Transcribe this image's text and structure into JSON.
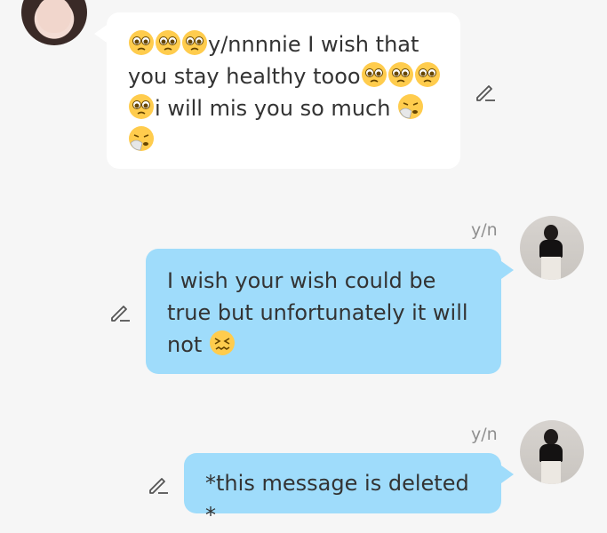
{
  "messages": [
    {
      "direction": "incoming",
      "text": "🥺🥺🥺y/nnnnie I wish that you stay healthy tooo🥺🥺🥺🥺i will mis you so much 🤧🤧"
    },
    {
      "direction": "outgoing",
      "sender": "y/n",
      "text": "I wish your wish could be true but unfortunately it will not 😖"
    },
    {
      "direction": "outgoing",
      "sender": "y/n",
      "text": "*this message is deleted *"
    }
  ],
  "colors": {
    "background": "#f6f6f6",
    "incoming_bubble": "#ffffff",
    "outgoing_bubble": "#9fdcfb",
    "sender_label": "#8f8f8f"
  },
  "icons": {
    "edit": "pencil-icon",
    "pleading": "pleading-face-emoji",
    "sneezing": "sneezing-face-emoji",
    "confounded": "confounded-face-emoji"
  }
}
